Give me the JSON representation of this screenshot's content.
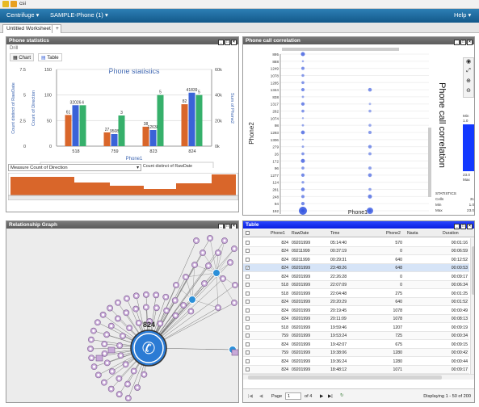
{
  "app": {
    "window_title": "csi"
  },
  "menubar": {
    "centrifuge": "Centrifuge ▾",
    "dataview": "SAMPLE-Phone (1) ▾",
    "help": "Help ▾"
  },
  "tabs": {
    "worksheet": "Untitled Worksheet",
    "add": "+"
  },
  "phone_stats": {
    "title": "Phone statistics",
    "drill": "Drill",
    "tab_chart": "Chart",
    "tab_table": "Table",
    "measure_label": "Measure Count of Direction",
    "chart_data": {
      "type": "bar",
      "title": "Phone statistics",
      "xlabel": "Phone1",
      "ylabel_left1": "Count distinct of RawDate",
      "ylabel_left2": "Count of Direction",
      "ylabel_right": "Sum of Phone2",
      "categories": [
        "518",
        "759",
        "823",
        "824"
      ],
      "series": [
        {
          "name": "Count of Direction",
          "color": "#d9662a",
          "values": [
            61,
            27,
            38,
            82
          ]
        },
        {
          "name": "Sum of Phone2",
          "color": "#3a63d8",
          "values": [
            32026,
            9508,
            12638,
            41839
          ]
        },
        {
          "name": "Count distinct of RawDate",
          "color": "#36b06b",
          "values": [
            4,
            3,
            5,
            5
          ]
        }
      ],
      "data_labels": [
        [
          "61",
          "32026",
          "4"
        ],
        [
          "27",
          "9508",
          "3"
        ],
        [
          "38",
          "12638",
          "5"
        ],
        [
          "82",
          "41839",
          "5"
        ]
      ],
      "left_axis1": {
        "ylim": [
          0,
          7.5
        ],
        "ticks": [
          "7.5",
          "5",
          "2.5",
          "0"
        ]
      },
      "left_axis2": {
        "ylim": [
          0,
          150
        ],
        "ticks": [
          "150",
          "100",
          "50",
          "0"
        ]
      },
      "right_axis": {
        "ylim": [
          0,
          60000
        ],
        "ticks": [
          "60k",
          "40k",
          "20k",
          "0k"
        ]
      },
      "legend_position": "bottom"
    }
  },
  "phone_corr": {
    "title": "Phone call correlation",
    "chart_title": "Phone call correlation",
    "xlabel": "Phone1",
    "ylabel": "Phone2",
    "y_ticks": [
      "895",
      "888",
      "1249",
      "1078",
      "1285",
      "1344",
      "838",
      "1317",
      "282",
      "1074",
      "98",
      "1293",
      "1306",
      "279",
      "26",
      "172",
      "96",
      "1277",
      "124",
      "281",
      "248",
      "94",
      "192"
    ],
    "x_ticks": [
      "824",
      "823"
    ],
    "legend": {
      "min_label": "Min",
      "min_value": "1.0",
      "max_value": "23.0",
      "max_label": "Max"
    },
    "stats": {
      "title": "STATISTICS",
      "cells_label": "Cells",
      "cells_value": "31",
      "min_label": "Min",
      "min_value": "1.0",
      "max_label": "Max",
      "max_value": "23.0"
    },
    "accent_color": "#1238ff"
  },
  "relationship": {
    "title": "Relationship Graph",
    "hub_label": "824"
  },
  "table": {
    "title": "Table",
    "columns": [
      "Phone1",
      "RawDate",
      "Time",
      "Phone2",
      "Nasta",
      "Duration"
    ],
    "rows": [
      [
        "824",
        "09201999",
        "05:14:40",
        "570",
        "",
        "00:01:16"
      ],
      [
        "824",
        "09211999",
        "00:37:19",
        "0",
        "",
        "00:06:59"
      ],
      [
        "824",
        "09211999",
        "00:29:31",
        "640",
        "",
        "00:12:52"
      ],
      [
        "824",
        "09201999",
        "23:48:26",
        "648",
        "",
        "00:00:53"
      ],
      [
        "824",
        "09201999",
        "22:26:28",
        "0",
        "",
        "00:09:17"
      ],
      [
        "518",
        "09201999",
        "22:07:09",
        "0",
        "",
        "00:06:34"
      ],
      [
        "518",
        "09201999",
        "22:04:48",
        "275",
        "",
        "00:01:25"
      ],
      [
        "824",
        "09201999",
        "20:20:29",
        "640",
        "",
        "00:01:52"
      ],
      [
        "824",
        "09201999",
        "20:19:45",
        "1078",
        "",
        "00:00:49"
      ],
      [
        "824",
        "09201999",
        "20:11:09",
        "1078",
        "",
        "00:08:13"
      ],
      [
        "518",
        "09201999",
        "19:59:46",
        "1207",
        "",
        "00:09:19"
      ],
      [
        "759",
        "09201999",
        "19:53:24",
        "725",
        "",
        "00:00:34"
      ],
      [
        "824",
        "09201999",
        "19:42:07",
        "675",
        "",
        "00:09:15"
      ],
      [
        "759",
        "09201999",
        "19:38:06",
        "1280",
        "",
        "00:00:42"
      ],
      [
        "824",
        "09201999",
        "19:36:24",
        "1280",
        "",
        "00:00:44"
      ],
      [
        "824",
        "09201999",
        "18:48:12",
        "1071",
        "",
        "00:09:17"
      ]
    ],
    "pager": {
      "page_label": "Page",
      "page_value": "1",
      "of_label": "of 4",
      "displaying": "Displaying 1 - 50 of 200"
    }
  }
}
